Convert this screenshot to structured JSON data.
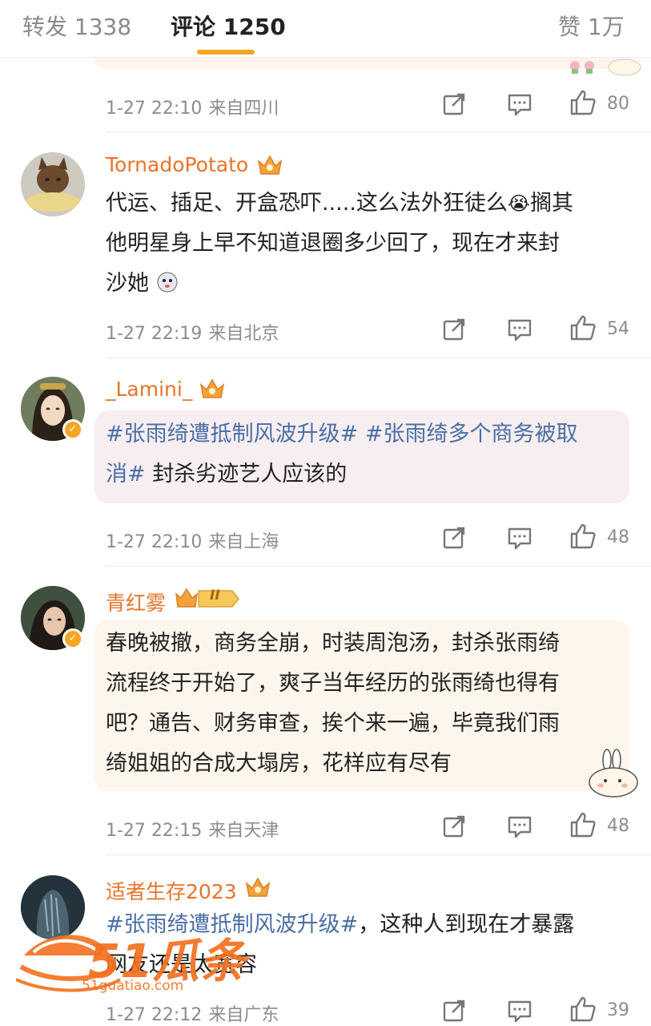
{
  "tabs": {
    "repost": "转发 1338",
    "comment": "评论 1250",
    "like": "赞 1万"
  },
  "colors": {
    "accent": "#f5a623",
    "username": "#e8742b",
    "topic": "#4a6fa5"
  },
  "comments": [
    {
      "time": "1-27 22:10",
      "location": "来自四川",
      "likes": "80"
    },
    {
      "user": "TornadoPotato",
      "lines": [
        "代运、插足、开盒恐吓.....这么法外狂徒么",
        "他明星身上早不知道退圈多少回了，现在才来封",
        "沙她"
      ],
      "emoji_after_line1": "😭",
      "tail_line1": "搁其",
      "time": "1-27 22:19",
      "location": "来自北京",
      "likes": "54"
    },
    {
      "user": "_Lamini_",
      "line1_topic1": "#张雨绮遭抵制风波升级#",
      "line1_topic2": "#张雨绮多个商务被取",
      "line2_topic": "消#",
      "line2_rest": " 封杀劣迹艺人应该的",
      "time": "1-27 22:10",
      "location": "来自上海",
      "likes": "48"
    },
    {
      "user": "青红雾",
      "level_badge": "II",
      "lines": [
        "春晚被撤，商务全崩，时装周泡汤，封杀张雨绮",
        "流程终于开始了，爽子当年经历的张雨绮也得有",
        "吧？通告、财务审查，挨个来一遍，毕竟我们雨",
        "绮姐姐的合成大塌房，花样应有尽有"
      ],
      "time": "1-27 22:15",
      "location": "来自天津",
      "likes": "48"
    },
    {
      "user": "适者生存2023",
      "line1_topic": "#张雨绮遭抵制风波升级#",
      "line1_rest": "，这种人到现在才暴露",
      "line2": "网友还是太宽容",
      "time": "1-27 22:12",
      "location": "来自广东",
      "likes": "39"
    }
  ],
  "watermark": {
    "brand": "51瓜条",
    "url": "51guatiao.com"
  }
}
